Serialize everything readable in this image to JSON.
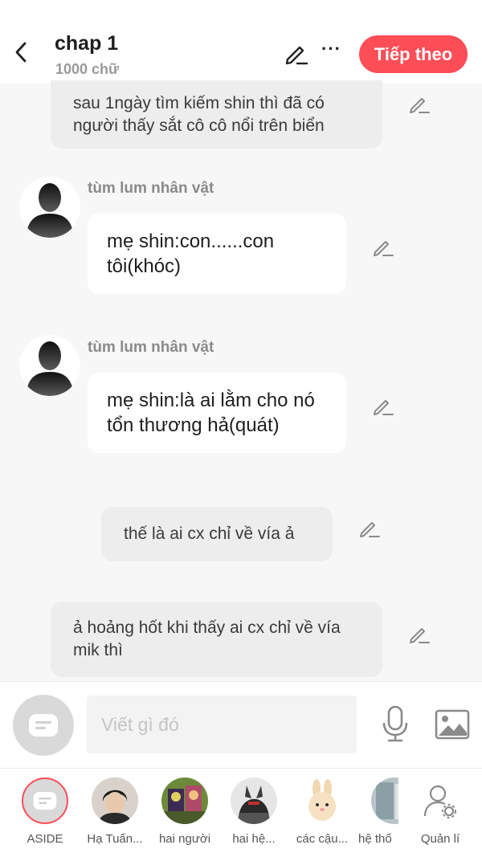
{
  "header": {
    "title": "chap 1",
    "word_count": "1000 chữ",
    "next_label": "Tiếp theo",
    "more_label": "···"
  },
  "messages": [
    {
      "type": "narration",
      "text": "sau 1ngày tìm kiếm shin thì đã có người thấy sắt cô cô nổi trên biển"
    },
    {
      "type": "character",
      "name": "tùm lum nhân vật",
      "text": "mẹ shin:con......con tôi(khóc)"
    },
    {
      "type": "character",
      "name": "tùm lum nhân vật",
      "text": "mẹ shin:là ai lằm cho nó tổn thương hả(quát)"
    },
    {
      "type": "narration",
      "text": "thế là ai cx chỉ về vía ả"
    },
    {
      "type": "narration",
      "text": "ả hoảng hốt khi thấy ai cx chỉ về vía mik thì"
    }
  ],
  "composer": {
    "placeholder": "Viết gì đó"
  },
  "character_bar": [
    {
      "label": "ASIDE",
      "icon": "aside-icon"
    },
    {
      "label": "Hạ Tuấn..."
    },
    {
      "label": "hai người"
    },
    {
      "label": "hai hệ..."
    },
    {
      "label": "các cậu..."
    },
    {
      "label": "hệ thố"
    },
    {
      "label": "Quản lí",
      "icon": "user-settings-icon"
    }
  ],
  "colors": {
    "accent": "#fd4d57",
    "narration_bg": "#ededed",
    "bubble_bg": "#ffffff",
    "background": "#f7f7f7"
  }
}
